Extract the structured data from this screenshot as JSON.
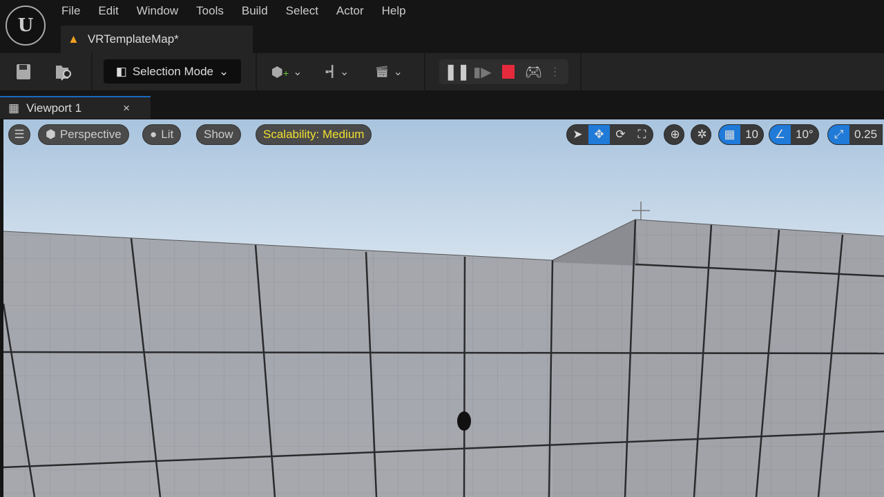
{
  "menu": [
    "File",
    "Edit",
    "Window",
    "Tools",
    "Build",
    "Select",
    "Actor",
    "Help"
  ],
  "map_tab": "VRTemplateMap*",
  "toolbar": {
    "mode": "Selection Mode"
  },
  "viewport_tab": {
    "label": "Viewport 1",
    "close": "×"
  },
  "viewport": {
    "perspective": "Perspective",
    "lit": "Lit",
    "show": "Show",
    "scalability": "Scalability: Medium",
    "grid_snap": "10",
    "rotation_snap": "10°",
    "scale_snap": "0.25"
  },
  "colors": {
    "accent": "#1f7ad8",
    "stop": "#e52a3c",
    "scalability_text": "#f0e030"
  }
}
